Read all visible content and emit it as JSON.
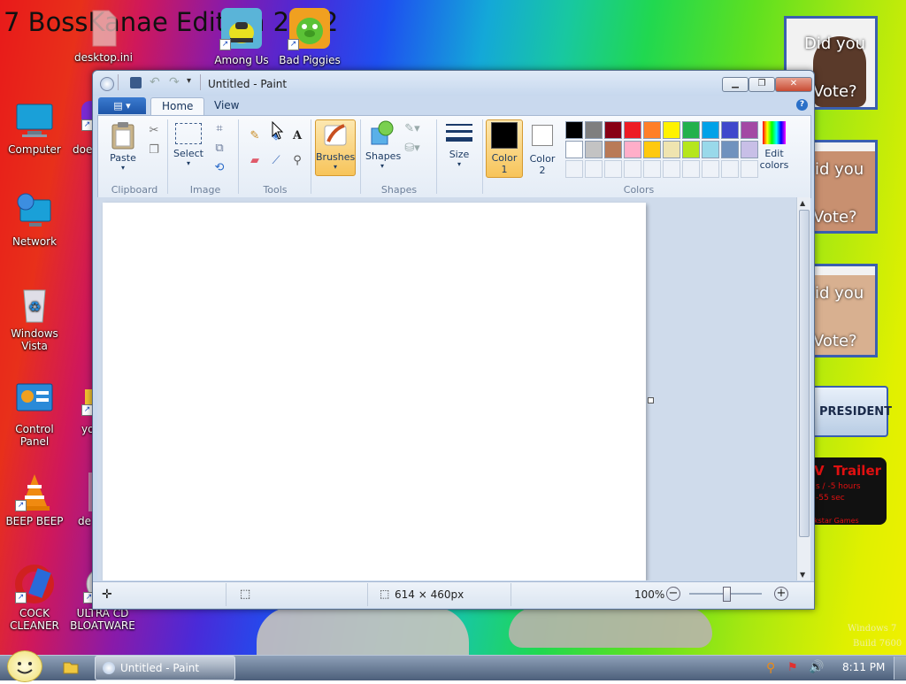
{
  "desktop": {
    "wallpaper_title": "7 BossKanae Edition 2012",
    "watermark_line1": "Windows 7",
    "watermark_line2": "Build 7600",
    "icons": [
      {
        "label": "desktop.ini",
        "icon": "file-icon"
      },
      {
        "label": "Among Us",
        "icon": "among-us-icon"
      },
      {
        "label": "Bad Piggies",
        "icon": "bad-piggies-icon"
      },
      {
        "label": "Computer",
        "icon": "computer-icon"
      },
      {
        "label": "doe",
        "icon": "partial-icon"
      },
      {
        "label": "Network",
        "icon": "network-icon"
      },
      {
        "label": "Windows Vista",
        "icon": "recycle-bin-icon"
      },
      {
        "label": "Control Panel",
        "icon": "control-panel-icon"
      },
      {
        "label": "yo",
        "icon": "partial-icon"
      },
      {
        "label": "BEEP BEEP",
        "icon": "vlc-icon"
      },
      {
        "label": "de",
        "icon": "partial-icon"
      },
      {
        "label": "COCK CLEANER",
        "icon": "ccleaner-icon"
      },
      {
        "label": "ULTRA CD BLOATWARE",
        "icon": "cd-icon"
      }
    ],
    "posters": [
      {
        "line1": "Did you",
        "line2": "Vote?"
      },
      {
        "line1": "id you",
        "line2": "Vote?"
      },
      {
        "line1": "id you",
        "line2": "Vote?"
      }
    ],
    "president_banner": "PRESIDENT",
    "trailer_banner": {
      "title": "V  Trailer",
      "line1": "s / -5 hours",
      "line2": "-55 sec",
      "line3": "kstar Games"
    }
  },
  "window": {
    "title": "Untitled - Paint",
    "min_label": "▁",
    "max_label": "❐",
    "close_label": "✕"
  },
  "ribbon": {
    "tabs": [
      {
        "label": "Home"
      },
      {
        "label": "View"
      }
    ],
    "help": "?",
    "clipboard": {
      "paste": "Paste",
      "group": "Clipboard"
    },
    "image": {
      "select": "Select",
      "group": "Image"
    },
    "tools": {
      "group": "Tools",
      "text_tool": "A"
    },
    "brushes": {
      "label": "Brushes"
    },
    "shapes": {
      "label": "Shapes",
      "group": "Shapes"
    },
    "size": {
      "label": "Size"
    },
    "color1": {
      "label": "Color",
      "num": "1"
    },
    "color2": {
      "label": "Color",
      "num": "2"
    },
    "edit_colors": {
      "line1": "Edit",
      "line2": "colors"
    },
    "colors_group": "Colors",
    "palette_row1": [
      "#000000",
      "#7f7f7f",
      "#880015",
      "#ed1c24",
      "#ff7f27",
      "#fff200",
      "#22b14c",
      "#00a2e8",
      "#3f48cc",
      "#a349a4"
    ],
    "palette_row2": [
      "#ffffff",
      "#c3c3c3",
      "#b97a57",
      "#ffaec9",
      "#ffc90e",
      "#efe4b0",
      "#b5e61d",
      "#99d9ea",
      "#7092be",
      "#c8bfe7"
    ],
    "color1_value": "#000000",
    "color2_value": "#ffffff"
  },
  "status": {
    "dimensions": "614 × 460px",
    "zoom": "100%"
  },
  "taskbar": {
    "task_label": "Untitled - Paint",
    "clock": "8:11 PM"
  }
}
